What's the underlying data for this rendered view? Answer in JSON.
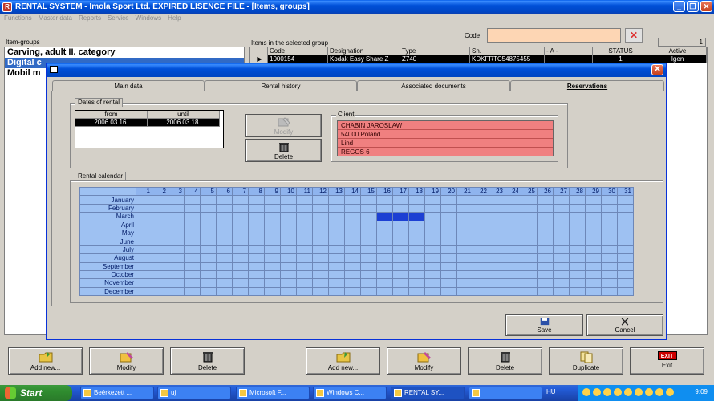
{
  "app": {
    "title": "RENTAL SYSTEM - Imola Sport Ltd.  EXPIRED LISENCE FILE - [Items, groups]",
    "icon": "app-icon",
    "window_buttons": [
      "_",
      "❐",
      "✕"
    ]
  },
  "menu": [
    "Functions",
    "Master data",
    "Reports",
    "Service",
    "Windows",
    "Help"
  ],
  "code": {
    "label": "Code",
    "value": "",
    "clear_glyph": "✕"
  },
  "item_groups": {
    "label": "Item-groups",
    "items": [
      {
        "label": "Carving, adult II. category",
        "selected": false
      },
      {
        "label": "Digital c",
        "selected": true
      },
      {
        "label": "Mobil m",
        "selected": false
      }
    ]
  },
  "items_grid": {
    "label": "Items in the selected group",
    "counter": "1",
    "columns": [
      "",
      "Code",
      "Designation",
      "Type",
      "Sn.",
      "- A -",
      "STATUS",
      "Active"
    ],
    "rows": [
      [
        "▶",
        "1000154",
        "Kodak Easy Share Z",
        "Z740",
        "KDKFRTC54875455",
        "",
        "1",
        "Igen"
      ]
    ]
  },
  "dialog": {
    "close_glyph": "✕",
    "tabs": [
      "Main data",
      "Rental history",
      "Associated documents",
      "Reservations"
    ],
    "active_tab": "Reservations",
    "dates": {
      "tab_label": "Dates of rental",
      "headers": [
        "from",
        "until"
      ],
      "row": [
        "2006.03.16.",
        "2006.03.18."
      ]
    },
    "modify_label": "Modify",
    "delete_label": "Delete",
    "client": {
      "label": "Client",
      "lines": [
        "CHABIN JAROSLAW",
        " 54000 Poland",
        "Lind",
        "REGOS  6"
      ]
    },
    "calendar": {
      "tab_label": "Rental calendar",
      "days": [
        "1",
        "2",
        "3",
        "4",
        "5",
        "6",
        "7",
        "8",
        "9",
        "10",
        "11",
        "12",
        "13",
        "14",
        "15",
        "16",
        "17",
        "18",
        "19",
        "20",
        "21",
        "22",
        "23",
        "24",
        "25",
        "26",
        "27",
        "28",
        "29",
        "30",
        "31"
      ],
      "months": [
        "January",
        "February",
        "March",
        "April",
        "May",
        "June",
        "July",
        "August",
        "September",
        "October",
        "November",
        "December"
      ],
      "reserved": [
        {
          "month": "March",
          "days": [
            16,
            17,
            18
          ]
        }
      ]
    },
    "save_label": "Save",
    "cancel_label": "Cancel"
  },
  "bottom_buttons": [
    {
      "label": "Add new...",
      "icon": "add-folder-icon"
    },
    {
      "label": "Modify",
      "icon": "modify-icon"
    },
    {
      "label": "Delete",
      "icon": "trash-icon"
    },
    {
      "label": "Add new...",
      "icon": "add-folder-icon"
    },
    {
      "label": "Modify",
      "icon": "modify-icon"
    },
    {
      "label": "Delete",
      "icon": "trash-icon"
    },
    {
      "label": "Duplicate",
      "icon": "duplicate-icon"
    },
    {
      "label": "Exit",
      "icon": "exit-icon",
      "badge": "EXIT"
    }
  ],
  "taskbar": {
    "start_label": "Start",
    "tasks": [
      "Beérkezett ...",
      "uj",
      "Microsoft F...",
      "Windows C...",
      "RENTAL SY...",
      ""
    ],
    "language": "HU",
    "clock": "9:09"
  }
}
